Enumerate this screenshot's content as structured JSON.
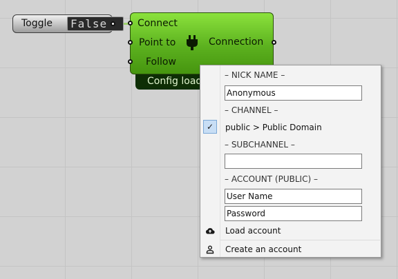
{
  "toggle": {
    "label": "Toggle",
    "value": "False"
  },
  "component": {
    "inputs": [
      "Connect",
      "Point to",
      "Follow"
    ],
    "output": "Connection",
    "footer": "Config load"
  },
  "menu": {
    "nick_header": "– NICK NAME –",
    "nick_value": "Anonymous",
    "channel_header": "– CHANNEL –",
    "channel_item": "public > Public Domain",
    "channel_checked": "✓",
    "subchannel_header": "– SUBCHANNEL –",
    "subchannel_value": "",
    "account_header": "– ACCOUNT (PUBLIC) –",
    "username_value": "User Name",
    "password_value": "Password",
    "load_account": "Load account",
    "create_account": "Create an account"
  },
  "colors": {
    "component_green": "#5cb11f",
    "wire": "#9fd16d",
    "menu_bg": "#f3f3f3",
    "check_highlight": "#c8def5"
  }
}
